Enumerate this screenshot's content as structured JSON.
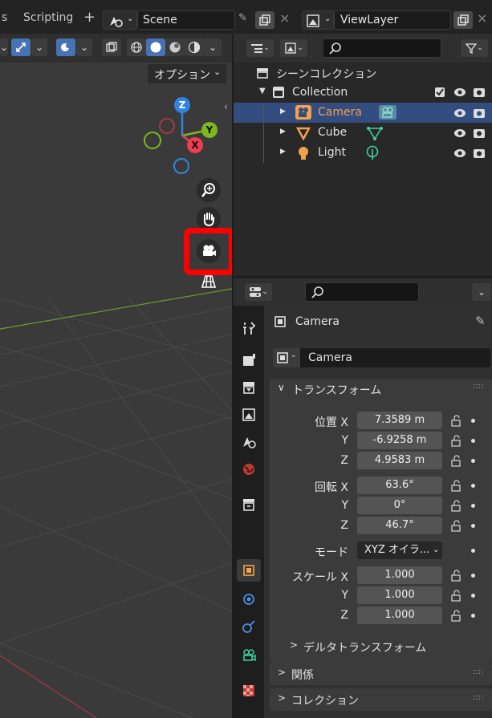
{
  "topbar": {
    "workspace_prev": "s",
    "workspace_tab": "Scripting",
    "add_tab": "+",
    "scene_name": "Scene",
    "viewlayer_name": "ViewLayer"
  },
  "viewport": {
    "options_label": "オプション",
    "gizmo": {
      "z": "Z",
      "y": "Y",
      "x": "X"
    }
  },
  "outliner": {
    "scene_collection": "シーンコレクション",
    "items": [
      {
        "label": "Collection"
      },
      {
        "label": "Camera"
      },
      {
        "label": "Cube"
      },
      {
        "label": "Light"
      }
    ]
  },
  "properties": {
    "object_name": "Camera",
    "object_field": "Camera",
    "transform_header": "トランスフォーム",
    "location_label": "位置 X",
    "rotation_label": "回転 X",
    "scale_label": "スケール X",
    "y_label": "Y",
    "z_label": "Z",
    "location": [
      "7.3589 m",
      "-6.9258 m",
      "4.9583 m"
    ],
    "rotation": [
      "63.6°",
      "0°",
      "46.7°"
    ],
    "mode_label": "モード",
    "mode_value": "XYZ オイラ...",
    "scale": [
      "1.000",
      "1.000",
      "1.000"
    ],
    "delta_transform": "デルタトランスフォーム",
    "relations": "関係",
    "collections": "コレクション"
  },
  "colors": {
    "accent": "#4772b3",
    "camera_orange": "#f5a04a",
    "highlight_red": "#ff0000",
    "axis_x": "#ee3d52",
    "axis_y": "#7fb71f",
    "axis_z": "#2f84e0"
  }
}
